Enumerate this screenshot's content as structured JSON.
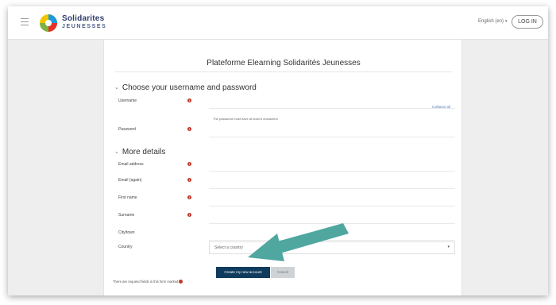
{
  "nav": {
    "logo_line1": "Solidarites",
    "logo_line2": "JEUNESSES",
    "language": "English (en)",
    "login_label": "LOG IN"
  },
  "form": {
    "title": "Plateforme Elearning Solidarités Jeunesses",
    "collapse_all": "Collapse all",
    "section1_title": "Choose your username and password",
    "section2_title": "More details",
    "username_label": "Username",
    "password_hint": "The password must have at least 8 characters",
    "password_label": "Password",
    "email_label": "Email address",
    "email_again_label": "Email (again)",
    "firstname_label": "First name",
    "surname_label": "Surname",
    "city_label": "City/town",
    "country_label": "Country",
    "country_placeholder": "Select a country",
    "create_button": "Create my new account",
    "cancel_button": "Cancel",
    "required_note": "There are required fields in this form marked"
  },
  "colors": {
    "primary_button": "#0f3b5e",
    "required_icon": "#c0392b",
    "annotation_arrow": "#4fa7a0"
  },
  "icons": {
    "menu": "hamburger-icon",
    "required": "exclamation-circle-icon",
    "collapse": "chevron-down-icon"
  }
}
